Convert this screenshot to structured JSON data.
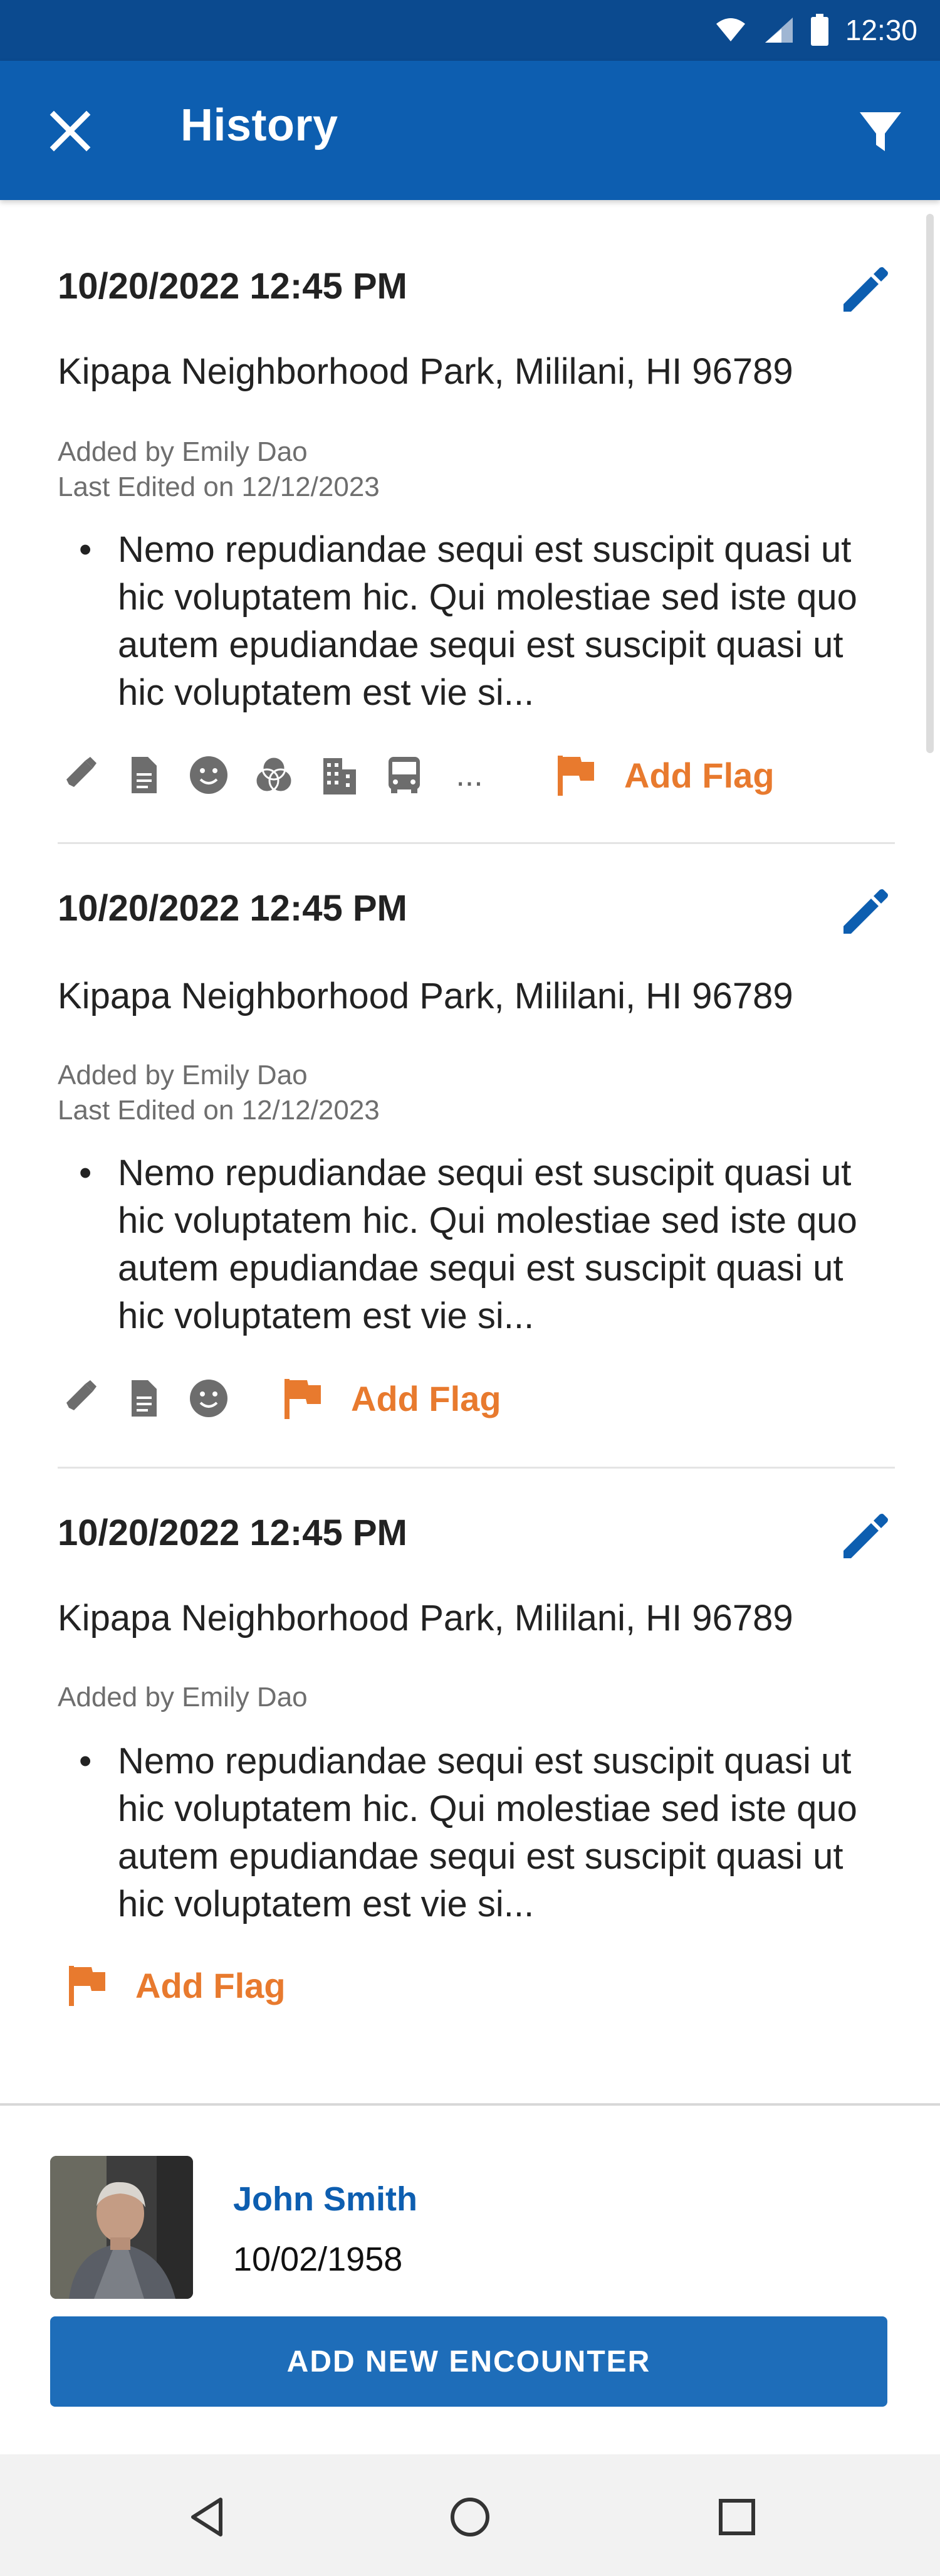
{
  "status_bar": {
    "time": "12:30",
    "icons": [
      "wifi-icon",
      "signal-icon",
      "battery-icon"
    ]
  },
  "app_bar": {
    "title": "History",
    "close_icon": "close-icon",
    "filter_icon": "filter-icon"
  },
  "colors": {
    "primary": "#0D5EB0",
    "status_bar": "#0B4A8F",
    "accent_flag": "#E87A2E",
    "button": "#1E6DB9"
  },
  "encounters": [
    {
      "datetime": "10/20/2022 12:45 PM",
      "location": "Kipapa Neighborhood Park, Mililani, HI 96789",
      "added_by": "Added by Emily Dao",
      "last_edited": "Last Edited on 12/12/2023",
      "note": "Nemo repudiandae sequi est suscipit quasi ut hic voluptatem hic. Qui molestiae sed iste quo autem epudiandae sequi est suscipit quasi ut hic voluptatem est vie si...",
      "icons": [
        "syringe-icon",
        "document-icon",
        "smiley-icon",
        "venn-icon",
        "building-icon",
        "bus-icon"
      ],
      "more": "...",
      "flag_label": "Add Flag"
    },
    {
      "datetime": "10/20/2022 12:45 PM",
      "location": "Kipapa Neighborhood Park, Mililani, HI 96789",
      "added_by": "Added by Emily Dao",
      "last_edited": "Last Edited on 12/12/2023",
      "note": "Nemo repudiandae sequi est suscipit quasi ut hic voluptatem hic. Qui molestiae sed iste quo autem epudiandae sequi est suscipit quasi ut hic voluptatem est vie si...",
      "icons": [
        "syringe-icon",
        "document-icon",
        "smiley-icon"
      ],
      "flag_label": "Add Flag"
    },
    {
      "datetime": "10/20/2022 12:45 PM",
      "location": "Kipapa Neighborhood Park, Mililani, HI 96789",
      "added_by": "Added by Emily Dao",
      "note": "Nemo repudiandae sequi est suscipit quasi ut hic voluptatem hic. Qui molestiae sed iste quo autem epudiandae sequi est suscipit quasi ut hic voluptatem est vie si...",
      "icons": [],
      "flag_label": "Add Flag"
    }
  ],
  "patient": {
    "name": "John Smith",
    "dob": "10/02/1958"
  },
  "footer": {
    "add_encounter_label": "ADD NEW ENCOUNTER"
  },
  "nav_bar": {
    "icons": [
      "back-icon",
      "home-icon",
      "recents-icon"
    ]
  }
}
